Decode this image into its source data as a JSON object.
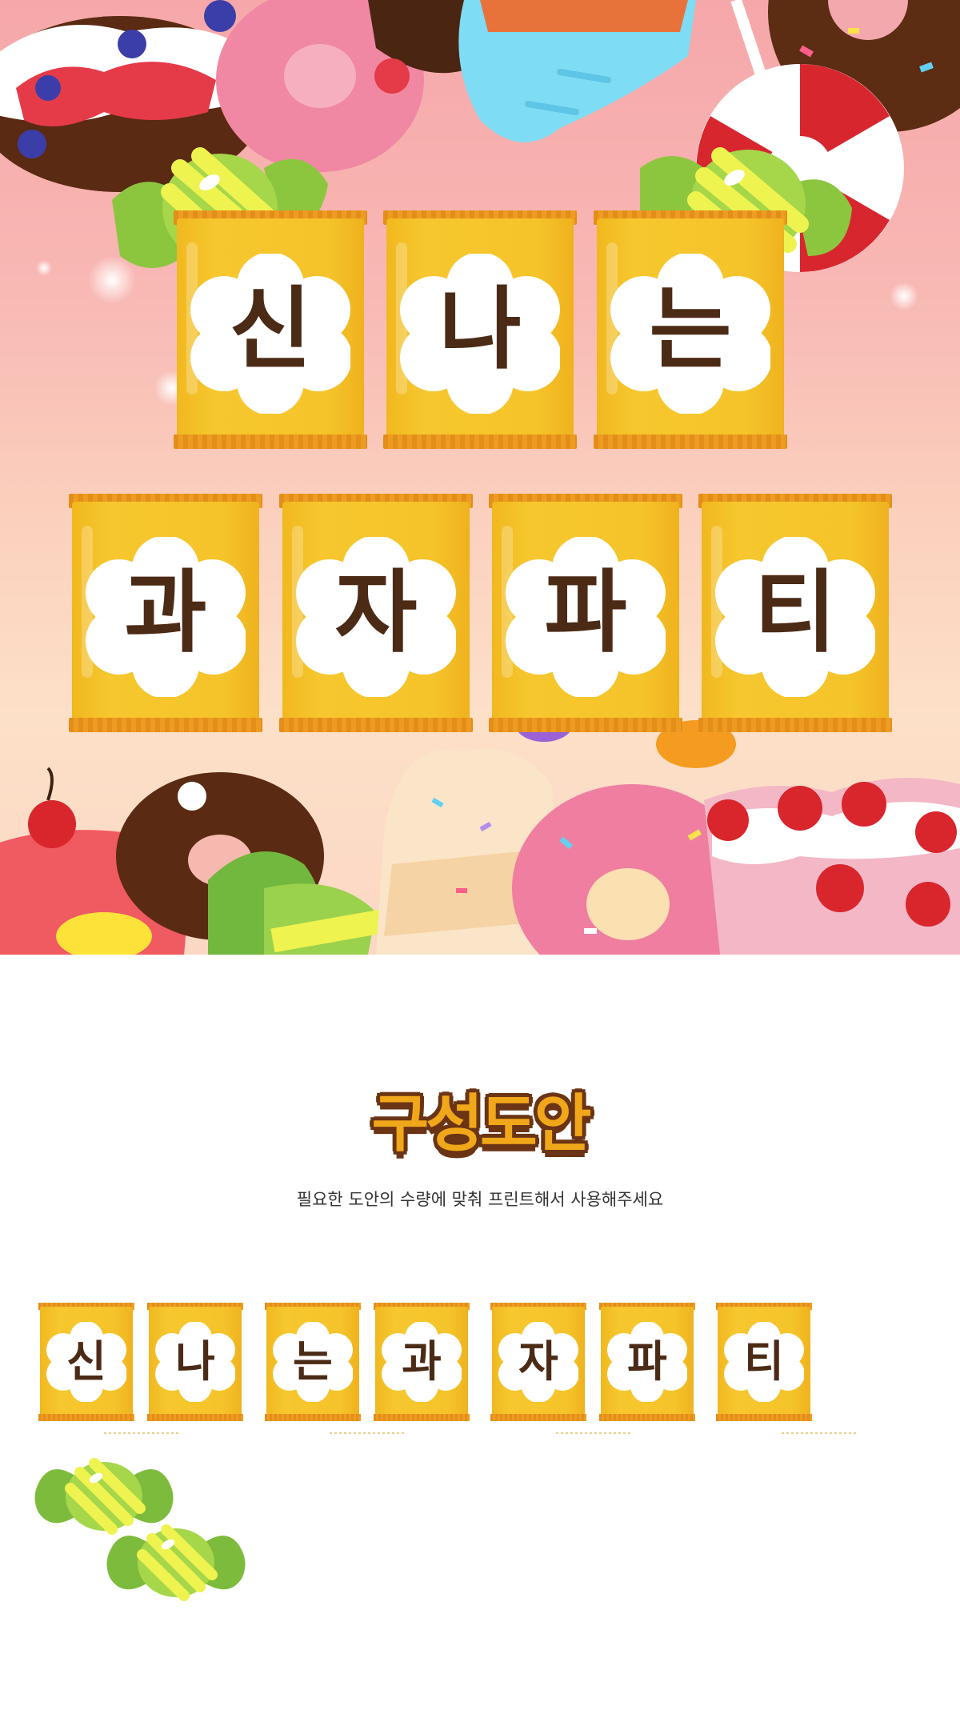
{
  "hero": {
    "row1": [
      "신",
      "나",
      "는"
    ],
    "row2": [
      "과",
      "자",
      "파",
      "티"
    ]
  },
  "section": {
    "title": "구성도안",
    "subtitle": "필요한 도안의 수량에 맞춰 프린트해서 사용해주세요",
    "pieces": [
      "신",
      "나",
      "는",
      "과",
      "자",
      "파",
      "티"
    ]
  },
  "colors": {
    "bag_yellow": "#f5c42a",
    "bag_crimp": "#e48d19",
    "letter_brown": "#4b2a16",
    "candy_green": "#8cc63f",
    "candy_yellow": "#f4ef5a"
  }
}
